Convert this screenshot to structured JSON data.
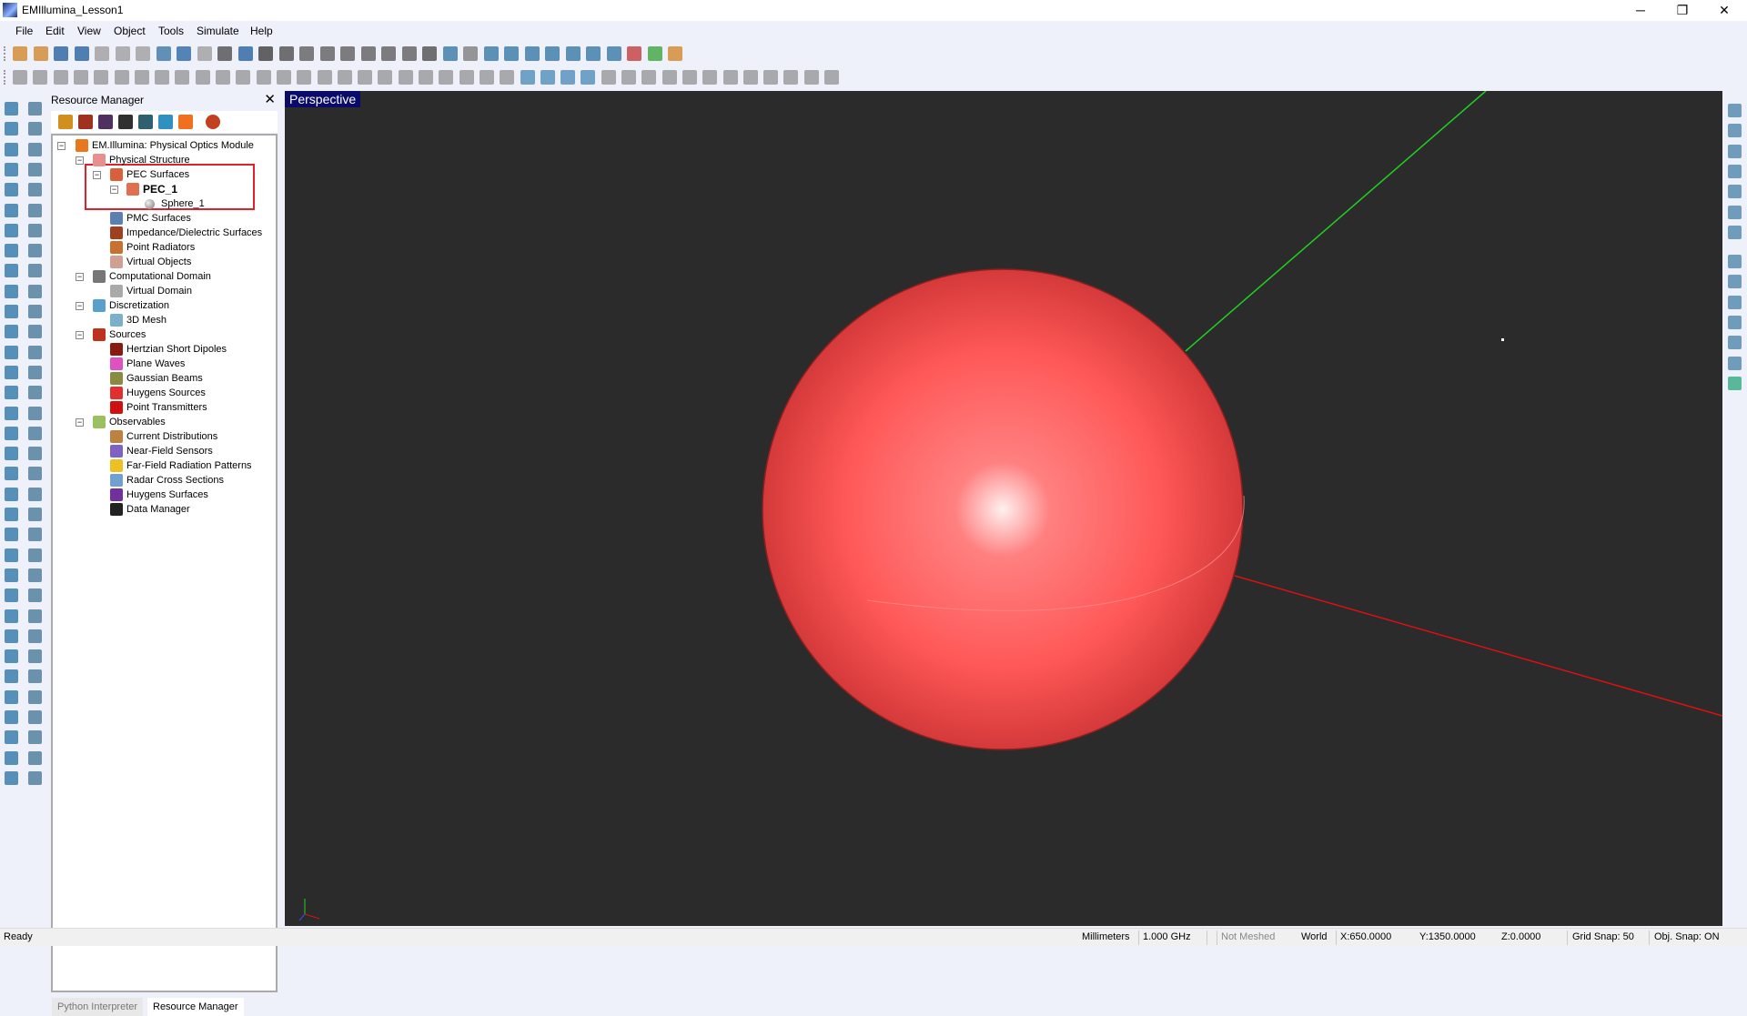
{
  "window": {
    "title": "EMIllumina_Lesson1",
    "minimize": "─",
    "maximize": "❐",
    "close": "✕"
  },
  "menu": [
    "File",
    "Edit",
    "View",
    "Object",
    "Tools",
    "Simulate",
    "Help"
  ],
  "resource_manager": {
    "title": "Resource Manager",
    "close": "✕",
    "tree": [
      {
        "label": "EM.Illumina: Physical Optics Module",
        "level": 0,
        "exp": true,
        "icon": "module-icon",
        "color": "#e8781e"
      },
      {
        "label": "Physical Structure",
        "level": 1,
        "exp": true,
        "icon": "structure-icon",
        "color": "#e89090"
      },
      {
        "label": "PEC Surfaces",
        "level": 2,
        "exp": true,
        "icon": "pec-surfaces-icon",
        "color": "#d9603a"
      },
      {
        "label": "PEC_1",
        "level": 3,
        "exp": true,
        "icon": "pec-group-icon",
        "color": "#e07050",
        "bold": true
      },
      {
        "label": "Sphere_1",
        "level": 4,
        "exp": false,
        "icon": "sphere-icon",
        "color": "#999"
      },
      {
        "label": "PMC Surfaces",
        "level": 2,
        "exp": false,
        "icon": "pmc-surfaces-icon",
        "color": "#5a7fb0"
      },
      {
        "label": "Impedance/Dielectric Surfaces",
        "level": 2,
        "exp": false,
        "icon": "impedance-surfaces-icon",
        "color": "#a04020"
      },
      {
        "label": "Point Radiators",
        "level": 2,
        "exp": false,
        "icon": "point-radiator-icon",
        "color": "#c87030"
      },
      {
        "label": "Virtual Objects",
        "level": 2,
        "exp": false,
        "icon": "virtual-objects-icon",
        "color": "#d0a090"
      },
      {
        "label": "Computational Domain",
        "level": 1,
        "exp": true,
        "icon": "domain-icon",
        "color": "#777"
      },
      {
        "label": "Virtual Domain",
        "level": 2,
        "exp": false,
        "icon": "virtual-domain-icon",
        "color": "#aaa"
      },
      {
        "label": "Discretization",
        "level": 1,
        "exp": true,
        "icon": "discretization-icon",
        "color": "#5aa0c8"
      },
      {
        "label": "3D Mesh",
        "level": 2,
        "exp": false,
        "icon": "mesh-icon",
        "color": "#7ab0c8"
      },
      {
        "label": "Sources",
        "level": 1,
        "exp": true,
        "icon": "sources-icon",
        "color": "#c03020"
      },
      {
        "label": "Hertzian Short Dipoles",
        "level": 2,
        "exp": false,
        "icon": "dipole-icon",
        "color": "#8a1a10"
      },
      {
        "label": "Plane Waves",
        "level": 2,
        "exp": false,
        "icon": "plane-wave-icon",
        "color": "#e050c0"
      },
      {
        "label": "Gaussian Beams",
        "level": 2,
        "exp": false,
        "icon": "gaussian-beam-icon",
        "color": "#8a8a40"
      },
      {
        "label": "Huygens Sources",
        "level": 2,
        "exp": false,
        "icon": "huygens-source-icon",
        "color": "#e03030"
      },
      {
        "label": "Point Transmitters",
        "level": 2,
        "exp": false,
        "icon": "point-transmitter-icon",
        "color": "#d01010"
      },
      {
        "label": "Observables",
        "level": 1,
        "exp": true,
        "icon": "observables-icon",
        "color": "#9ac060"
      },
      {
        "label": "Current Distributions",
        "level": 2,
        "exp": false,
        "icon": "current-distribution-icon",
        "color": "#c08040"
      },
      {
        "label": "Near-Field Sensors",
        "level": 2,
        "exp": false,
        "icon": "near-field-icon",
        "color": "#8060c0"
      },
      {
        "label": "Far-Field Radiation Patterns",
        "level": 2,
        "exp": false,
        "icon": "far-field-icon",
        "color": "#f0c020"
      },
      {
        "label": "Radar Cross Sections",
        "level": 2,
        "exp": false,
        "icon": "rcs-icon",
        "color": "#70a0d0"
      },
      {
        "label": "Huygens Surfaces",
        "level": 2,
        "exp": false,
        "icon": "huygens-surface-icon",
        "color": "#7030a0"
      },
      {
        "label": "Data Manager",
        "level": 2,
        "exp": false,
        "icon": "data-manager-icon",
        "color": "#222"
      }
    ],
    "tabs": [
      "Python Interpreter",
      "Resource Manager"
    ]
  },
  "viewport": {
    "label": "Perspective",
    "sphere_color": "#ff5a5a",
    "x_axis_color": "#e01010",
    "y_axis_color": "#20d020"
  },
  "status": {
    "ready": "Ready",
    "units": "Millimeters",
    "frequency": "1.000 GHz",
    "mesh": "Not Meshed",
    "coords": "World",
    "x": "X:650.0000",
    "y": "Y:1350.0000",
    "z": "Z:0.0000",
    "grid_snap": "Grid Snap: 50",
    "obj_snap": "Obj. Snap: ON"
  }
}
